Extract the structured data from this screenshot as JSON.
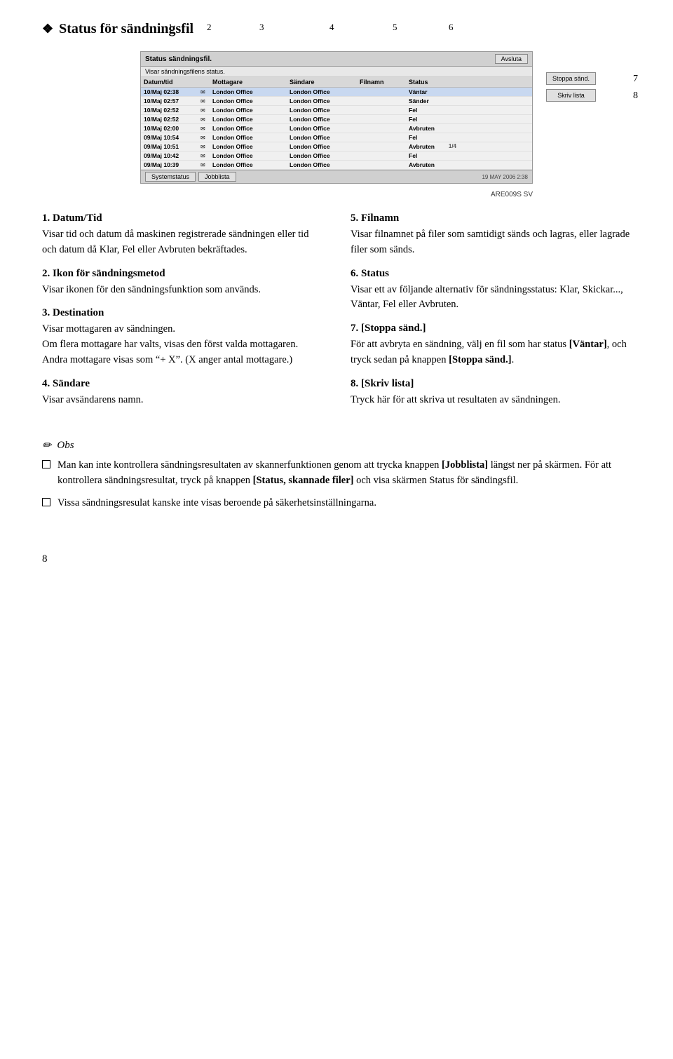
{
  "page": {
    "title": "Status för sändningsfil",
    "diamond": "❖",
    "are_code": "ARE009S SV",
    "page_number": "8"
  },
  "diagram": {
    "header_title": "Status sändningsfil.",
    "avsluta_btn": "Avsluta",
    "subheader": "Visar sändningsfilens status.",
    "columns": [
      "Datum/tid",
      "Mottagare",
      "Sändare",
      "Filnamn",
      "Status"
    ],
    "stoppa_btn": "Stoppa sänd.",
    "skriv_btn": "Skriv lista",
    "rows": [
      {
        "datum": "10/Maj 02:38",
        "ikon": "✉",
        "mott": "London Office",
        "sand": "London Office",
        "filnamn": "",
        "status": "Väntar",
        "highlight": true
      },
      {
        "datum": "10/Maj 02:57",
        "ikon": "✉",
        "mott": "London Office",
        "sand": "London Office",
        "filnamn": "",
        "status": "Sänder",
        "highlight": false
      },
      {
        "datum": "10/Maj 02:52",
        "ikon": "✉",
        "mott": "London Office",
        "sand": "London Office",
        "filnamn": "",
        "status": "Fel",
        "highlight": false
      },
      {
        "datum": "10/Maj 02:52",
        "ikon": "✉",
        "mott": "London Office",
        "sand": "London Office",
        "filnamn": "",
        "status": "Fel",
        "highlight": false
      },
      {
        "datum": "10/Maj 02:00",
        "ikon": "✉",
        "mott": "London Office",
        "sand": "London Office",
        "filnamn": "",
        "status": "Avbruten",
        "highlight": false
      },
      {
        "datum": "09/Maj 10:54",
        "ikon": "✉",
        "mott": "London Office",
        "sand": "London Office",
        "filnamn": "",
        "status": "Fel",
        "highlight": false
      },
      {
        "datum": "09/Maj 10:51",
        "ikon": "✉",
        "mott": "London Office",
        "sand": "London Office",
        "filnamn": "",
        "status": "Avbruten",
        "highlight": false
      },
      {
        "datum": "09/Maj 10:42",
        "ikon": "✉",
        "mott": "London Office",
        "sand": "London Office",
        "filnamn": "",
        "status": "Fel",
        "highlight": false
      },
      {
        "datum": "09/Maj 10:39",
        "ikon": "✉",
        "mott": "London Office",
        "sand": "London Office",
        "filnamn": "",
        "status": "Avbruten",
        "highlight": false
      }
    ],
    "page_indicator": "1/4",
    "footer_btns": [
      "Systemstatus",
      "Jobblista"
    ],
    "date_footer": "19 MAY 2006  2:38",
    "num_labels": [
      "1",
      "2",
      "3",
      "4",
      "5",
      "6"
    ],
    "side_labels": [
      "7",
      "8"
    ]
  },
  "sections": {
    "left": [
      {
        "id": "s1",
        "number": "1.",
        "heading": "Datum/Tid",
        "text": "Visar tid och datum då maskinen registrerade sändningen eller tid och datum då Klar, Fel eller Avbruten bekräftades."
      },
      {
        "id": "s2",
        "number": "2.",
        "heading": "Ikon för sändningsmetod",
        "text": "Visar ikonen för den sändningsfunktion som används."
      },
      {
        "id": "s3",
        "number": "3.",
        "heading": "Destination",
        "text1": "Visar mottagaren av sändningen.",
        "text2": "Om flera mottagare har valts, visas den först valda mottagaren.",
        "text3": "Andra mottagare visas som “+ X”. (X anger antal mottagare.)"
      },
      {
        "id": "s4",
        "number": "4.",
        "heading": "Sändare",
        "text": "Visar avsändarens namn."
      }
    ],
    "right": [
      {
        "id": "s5",
        "number": "5.",
        "heading": "Filnamn",
        "text": "Visar filnamnet på filer som samtidigt sänds och lagras, eller lagrade filer som sänds."
      },
      {
        "id": "s6",
        "number": "6.",
        "heading": "Status",
        "text": "Visar ett av följande alternativ för sändningsstatus: Klar, Skickar..., Väntar, Fel eller Avbruten."
      },
      {
        "id": "s7",
        "number": "7.",
        "heading": "[Stoppa sänd.]",
        "text": "För att avbryta en sändning, välj en fil som har status [Väntar], och tryck sedan på knappen [Stoppa sänd.]."
      },
      {
        "id": "s8",
        "number": "8.",
        "heading": "[Skriv lista]",
        "text": "Tryck här för att skriva ut resultaten av sändningen."
      }
    ]
  },
  "obs": {
    "header": "Obs",
    "items": [
      "Man kan inte kontrollera sändningsresultaten av skannerfunktionen genom att trycka knappen [Jobblista] längst ner på skärmen. För att kontrollera sändningsresultat, tryck på knappen [Status, skannade filer] och visa skärmen Status för sändingsfil.",
      "Vissa sändningsresulat kanske inte visas beroende på säkerhetsinställningarna."
    ]
  }
}
